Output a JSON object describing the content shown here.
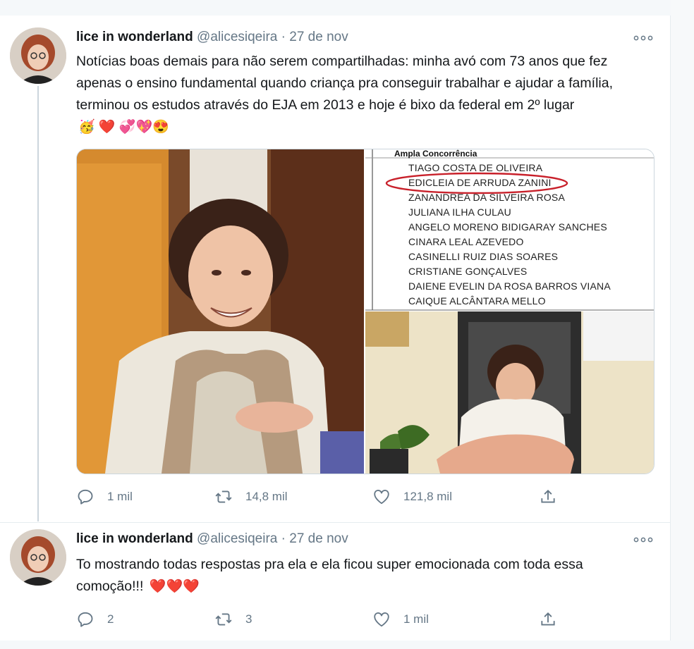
{
  "tweets": [
    {
      "name": "lice in wonderland",
      "handle": "@alicesiqeira",
      "separator": "·",
      "date": "27 de nov",
      "text": "Notícias boas demais para não serem compartilhadas: minha avó com 73 anos que fez apenas o ensino fundamental quando criança pra conseguir trabalhar e ajudar a família, terminou os estudos através do EJA em 2013 e hoje é bixo da federal em 2º lugar",
      "emojis": "🥳 ❤️ 💞💖😍",
      "media": {
        "list_header": "Ampla Concorrência",
        "list_items": [
          "TIAGO COSTA DE OLIVEIRA",
          "EDICLEIA DE ARRUDA ZANINI",
          "ZANANDREA DA SILVEIRA ROSA",
          "JULIANA ILHA CULAU",
          "ANGELO MORENO BIDIGARAY SANCHES",
          "CINARA LEAL AZEVEDO",
          "CASINELLI RUIZ DIAS SOARES",
          "CRISTIANE GONÇALVES",
          "DAIENE EVELIN DA ROSA BARROS VIANA",
          "CAIQUE ALCÂNTARA MELLO"
        ],
        "highlighted_index": 1
      },
      "actions": {
        "replies": "1 mil",
        "retweets": "14,8 mil",
        "likes": "121,8 mil"
      }
    },
    {
      "name": "lice in wonderland",
      "handle": "@alicesiqeira",
      "separator": "·",
      "date": "27 de nov",
      "text": "To mostrando todas respostas pra ela e ela ficou super emocionada com toda essa comoção!!!",
      "emojis": "❤️❤️❤️",
      "actions": {
        "replies": "2",
        "retweets": "3",
        "likes": "1 mil"
      }
    }
  ],
  "colors": {
    "text": "#14171a",
    "secondary": "#657786",
    "divider": "#e6ecf0",
    "heart": "#e0245e",
    "circle": "#c8202a"
  },
  "icons": [
    "more-icon",
    "reply-icon",
    "retweet-icon",
    "like-icon",
    "share-icon"
  ]
}
